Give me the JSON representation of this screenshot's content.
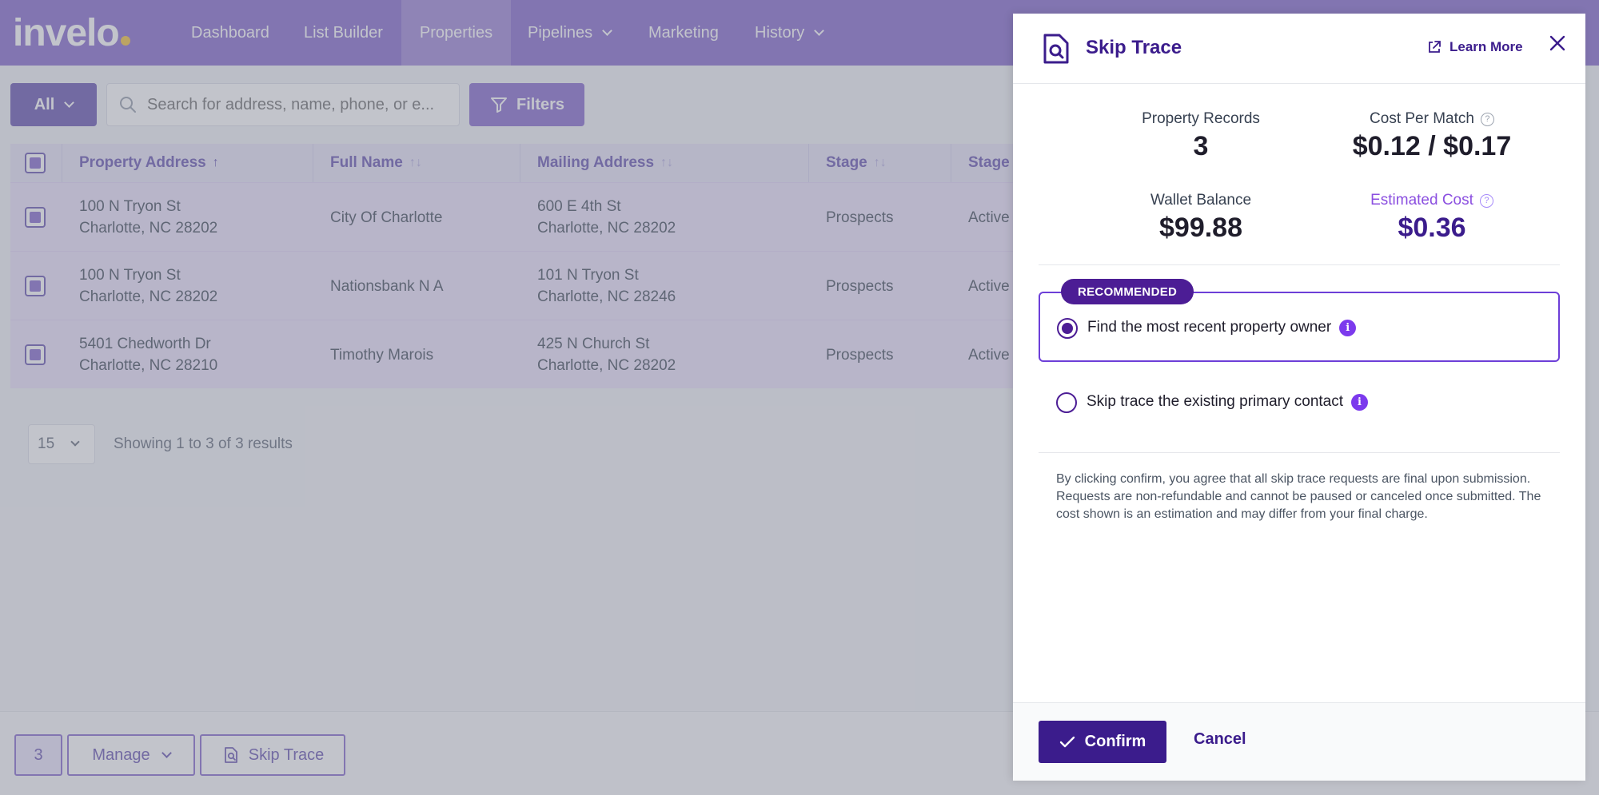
{
  "app": {
    "logo": "invelo",
    "nav": [
      {
        "label": "Dashboard"
      },
      {
        "label": "List Builder"
      },
      {
        "label": "Properties"
      },
      {
        "label": "Pipelines"
      },
      {
        "label": "Marketing"
      },
      {
        "label": "History"
      }
    ]
  },
  "toolbar": {
    "all_label": "All",
    "search_placeholder": "Search for address, name, phone, or e...",
    "filters_label": "Filters"
  },
  "table": {
    "columns": [
      "Property Address",
      "Full Name",
      "Mailing Address",
      "Stage",
      "Stage"
    ],
    "rows": [
      {
        "address1": "100 N Tryon St",
        "address2": "Charlotte, NC 28202",
        "name": "City Of Charlotte",
        "mail1": "600 E 4th St",
        "mail2": "Charlotte, NC 28202",
        "stage": "Prospects",
        "stage2": "Active"
      },
      {
        "address1": "100 N Tryon St",
        "address2": "Charlotte, NC 28202",
        "name": "Nationsbank N A",
        "mail1": "101 N Tryon St",
        "mail2": "Charlotte, NC 28246",
        "stage": "Prospects",
        "stage2": "Active"
      },
      {
        "address1": "5401 Chedworth Dr",
        "address2": "Charlotte, NC 28210",
        "name": "Timothy Marois",
        "mail1": "425 N Church St",
        "mail2": "Charlotte, NC 28202",
        "stage": "Prospects",
        "stage2": "Active"
      }
    ]
  },
  "pagination": {
    "per_page": "15",
    "summary": "Showing 1 to 3 of 3 results"
  },
  "bottom": {
    "selected_count": "3",
    "manage_label": "Manage",
    "skip_label": "Skip Trace"
  },
  "modal": {
    "title": "Skip Trace",
    "learn_more": "Learn More",
    "stats": {
      "records_label": "Property Records",
      "records_value": "3",
      "cost_label": "Cost Per Match",
      "cost_value": "$0.12 / $0.17",
      "wallet_label": "Wallet Balance",
      "wallet_value": "$99.88",
      "estimated_label": "Estimated Cost",
      "estimated_value": "$0.36"
    },
    "recommended_badge": "RECOMMENDED",
    "option1": "Find the most recent property owner",
    "option2": "Skip trace the existing primary contact",
    "disclaimer": "By clicking confirm, you agree that all skip trace requests are final upon submission. Requests are non-refundable and cannot be paused or canceled once submitted. The cost shown is an estimation and may differ from your final charge.",
    "confirm_label": "Confirm",
    "cancel_label": "Cancel"
  },
  "colors": {
    "nav_bg": "#8b6fd0",
    "primary_dark": "#3b1c8c",
    "accent": "#7c3aed",
    "row_selected": "#ede4fb"
  },
  "icons": {
    "search": "search-icon",
    "filter": "filter-icon",
    "skip_trace": "skip-trace-icon",
    "external_link": "external-link-icon",
    "close": "close-icon",
    "check": "check-icon",
    "info": "info-icon",
    "help": "help-circle-icon"
  }
}
